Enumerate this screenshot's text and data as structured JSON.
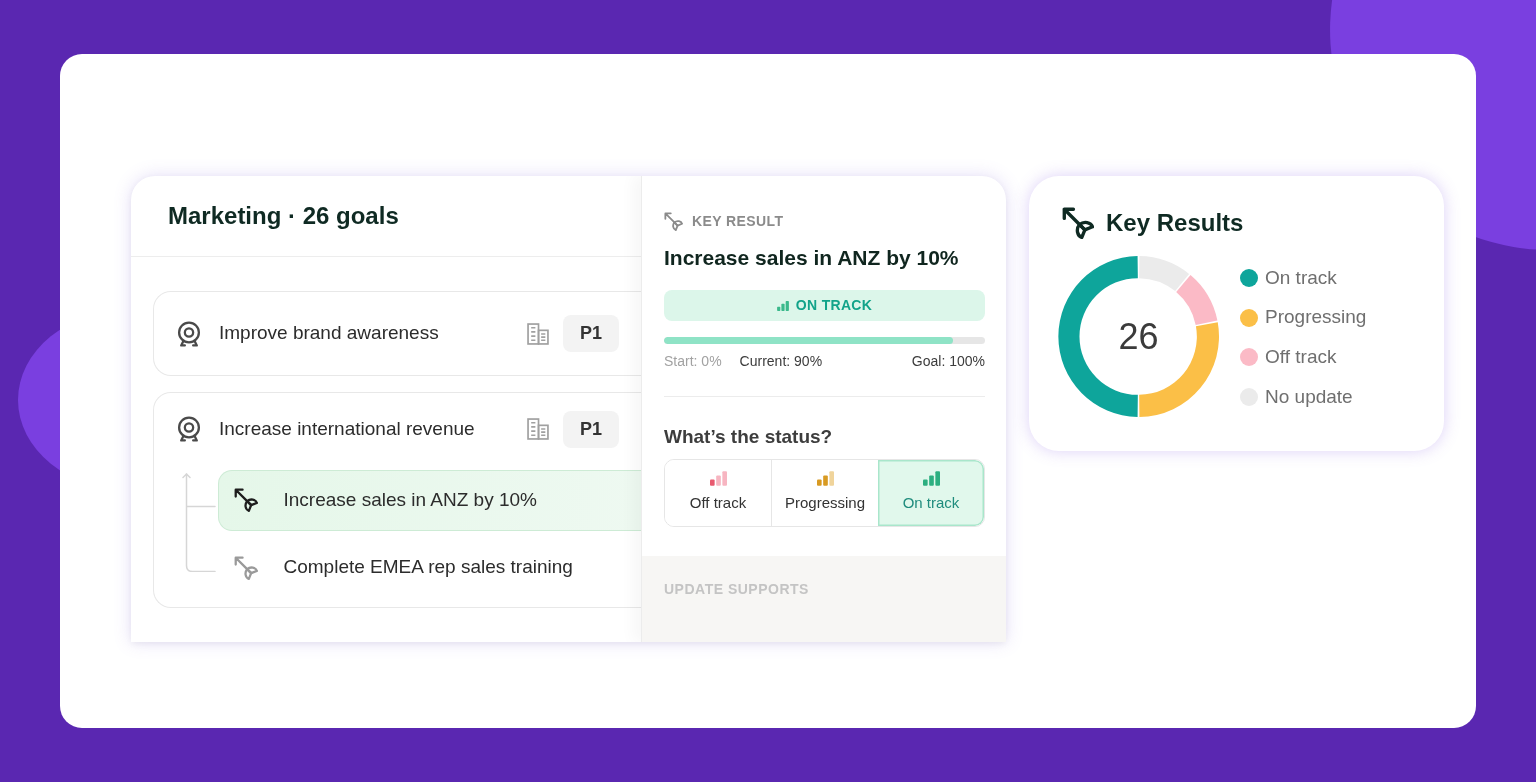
{
  "goals_panel": {
    "title": "Marketing · 26 goals",
    "goals": [
      {
        "title": "Improve brand awareness",
        "priority": "P1",
        "selected": false
      },
      {
        "title": "Increase international revenue",
        "priority": "P1",
        "selected": false,
        "children": [
          {
            "title": "Increase sales in ANZ by 10%",
            "selected": true
          },
          {
            "title": "Complete EMEA rep sales training",
            "selected": false
          }
        ]
      }
    ]
  },
  "key_result_panel": {
    "label": "KEY RESULT",
    "title": "Increase sales in ANZ by 10%",
    "status": {
      "label": "ON TRACK",
      "kind": "on_track"
    },
    "progress": {
      "level": 0.9,
      "start": "Start: 0%",
      "current": "Current: 90%",
      "goal": "Goal: 100%"
    },
    "question": "What’s the status?",
    "status_options": [
      {
        "label": "Off track",
        "kind": "off_track",
        "selected": false
      },
      {
        "label": "Progressing",
        "kind": "progressing",
        "selected": false
      },
      {
        "label": "On track",
        "kind": "on_track",
        "selected": true
      }
    ],
    "footer": "UPDATE SUPPORTS"
  },
  "key_results_card": {
    "title": "Key Results",
    "total": "26",
    "legend": [
      {
        "label": "On track",
        "color": "#0ea59b"
      },
      {
        "label": "Progressing",
        "color": "#fbbf47"
      },
      {
        "label": "Off track",
        "color": "#fbbac6"
      },
      {
        "label": "No update",
        "color": "#ebebeb"
      }
    ]
  }
}
